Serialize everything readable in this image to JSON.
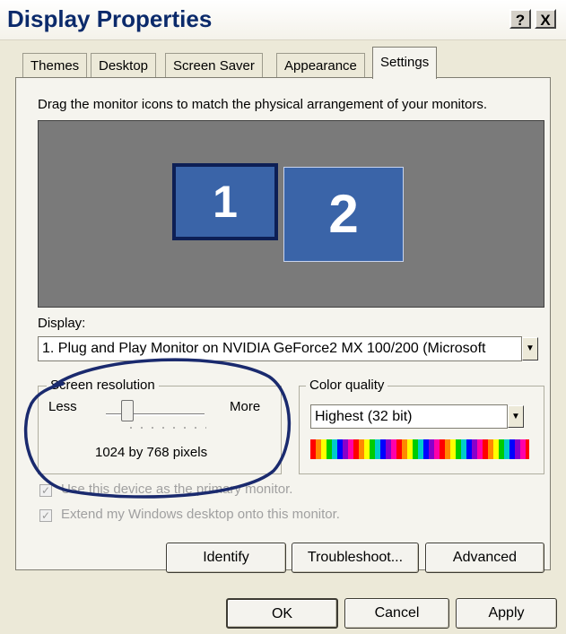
{
  "window": {
    "title": "Display Properties",
    "help_button": "?",
    "close_button": "X"
  },
  "tabs": [
    {
      "label": "Themes"
    },
    {
      "label": "Desktop"
    },
    {
      "label": "Screen Saver"
    },
    {
      "label": "Appearance"
    },
    {
      "label": "Settings",
      "active": true
    }
  ],
  "settings": {
    "instructions": "Drag the monitor icons to match the physical arrangement of your monitors.",
    "monitors": [
      {
        "label": "1",
        "selected": true
      },
      {
        "label": "2",
        "selected": false
      }
    ],
    "display_label": "Display:",
    "display_value": "1. Plug and Play Monitor on NVIDIA GeForce2 MX 100/200 (Microsoft",
    "screen_resolution": {
      "group_label": "Screen resolution",
      "less_label": "Less",
      "more_label": "More",
      "value_text": "1024 by 768 pixels",
      "slider_level": 0.2
    },
    "color_quality": {
      "group_label": "Color quality",
      "selected": "Highest (32 bit)"
    },
    "checkboxes": [
      {
        "label": "Use this device as the primary monitor.",
        "checked": true,
        "disabled": true
      },
      {
        "label": "Extend my Windows desktop onto this monitor.",
        "checked": true,
        "disabled": true
      }
    ],
    "buttons": {
      "identify": "Identify",
      "troubleshoot": "Troubleshoot...",
      "advanced": "Advanced"
    }
  },
  "dialog_buttons": {
    "ok": "OK",
    "cancel": "Cancel",
    "apply": "Apply"
  },
  "colors": {
    "annotation_circle": "#1a2a6e",
    "monitor_fill": "#3a64a8",
    "monitor_area": "#7a7a7a"
  }
}
